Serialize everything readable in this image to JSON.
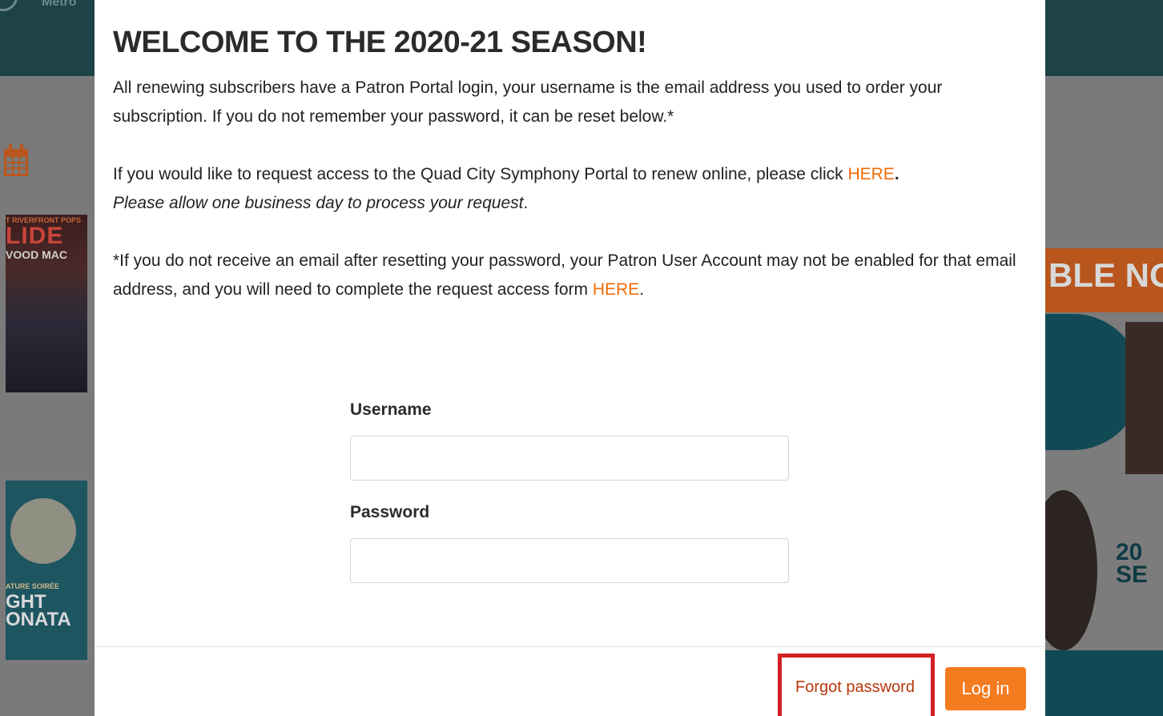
{
  "background": {
    "header_logo_text": "Metro",
    "poster1": {
      "line1": "T RIVERFRONT POPS",
      "line2": "LIDE",
      "line3": "VOOD MAC"
    },
    "poster2": {
      "line1": "ATURE SOIRÉE",
      "line2": "GHT",
      "line3": "ONATA"
    },
    "right_banner": "BLE NO",
    "right_year": "20\nSE"
  },
  "modal": {
    "title": "WELCOME TO THE 2020-21 SEASON!",
    "para1": "All renewing subscribers have a Patron Portal login, your username is the email address you used to order your subscription. If you do not remember your password, it can be reset below.*",
    "para2_prefix": "If you would like to request access to the Quad City Symphony Portal to renew online, please click ",
    "para2_link": "HERE",
    "para2_suffix": ".",
    "para2_italic": "Please allow one business day to process your request",
    "para2_end": ".",
    "para3_prefix": "*If you do not receive an email after resetting your password,  your Patron User Account may not be enabled for that email address, and you will need to complete the request access form ",
    "para3_link": "HERE",
    "para3_suffix": "."
  },
  "form": {
    "username_label": "Username",
    "username_value": "",
    "password_label": "Password",
    "password_value": ""
  },
  "footer": {
    "forgot_label": "Forgot password",
    "login_label": "Log in"
  },
  "colors": {
    "accent": "#f57b1f",
    "link": "#f26b08",
    "highlight_border": "#d42027"
  }
}
